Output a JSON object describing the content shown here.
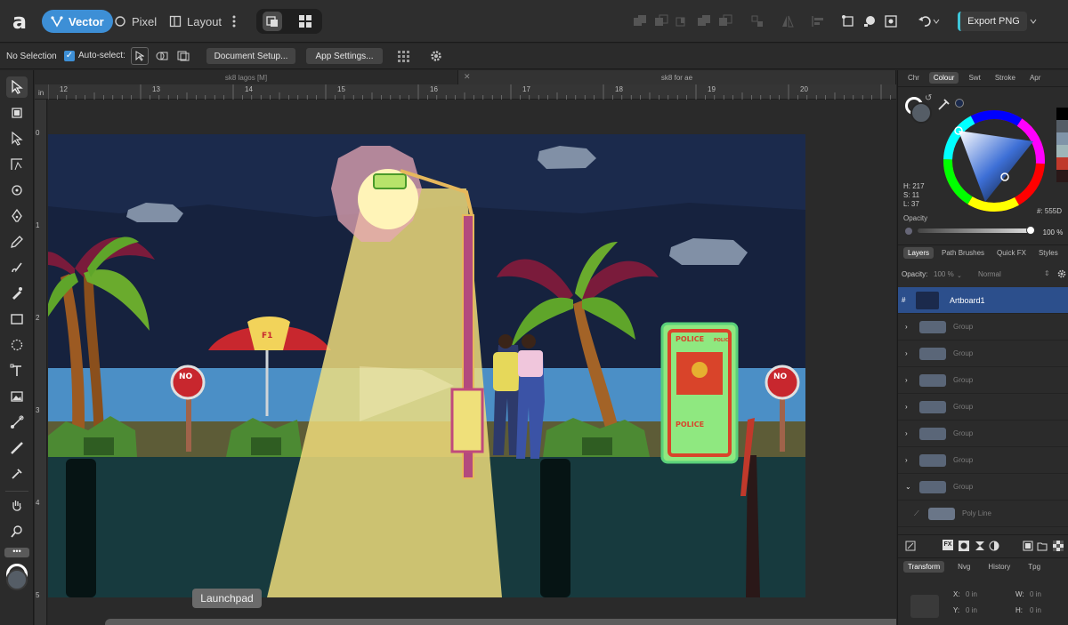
{
  "app": {
    "personas": [
      {
        "label": "Vector",
        "active": true
      },
      {
        "label": "Pixel",
        "active": false
      },
      {
        "label": "Layout",
        "active": false
      }
    ],
    "export_label": "Export PNG",
    "accent": "#3d8fd6"
  },
  "context": {
    "selection": "No Selection",
    "autoselect_label": "Auto-select:",
    "document_setup": "Document Setup...",
    "app_settings": "App Settings..."
  },
  "tabs": [
    {
      "label": "sk8 lagos [M]",
      "active": false
    },
    {
      "label": "sk8 for ae",
      "active": true
    }
  ],
  "ruler": {
    "unit": "in",
    "h_ticks": [
      "12",
      "13",
      "14",
      "15",
      "16",
      "17",
      "18",
      "19",
      "20"
    ],
    "v_ticks": [
      "0",
      "1",
      "2",
      "3",
      "4",
      "5"
    ]
  },
  "canvas": {
    "sign_text": "NO",
    "booth_top": "POLICE",
    "booth_side": "POLICE",
    "booth_bottom": "POLICE",
    "umbrella_text": "F1",
    "launchpad_label": "Launchpad",
    "sky_color": "#1b2a4c",
    "sea_color": "#4b8fc6",
    "ground_color": "#173a3e",
    "light_color": "#f4e07c"
  },
  "colour_panel": {
    "tabs": [
      "Chr",
      "Colour",
      "Swt",
      "Stroke",
      "Apr"
    ],
    "active_tab": "Colour",
    "h": "H: 217",
    "s": "S: 11",
    "l": "L: 37",
    "hex": "#: 555D",
    "opacity_label": "Opacity",
    "opacity_value": "100 %",
    "current_color": "#555d66"
  },
  "layers_panel": {
    "tabs": [
      "Layers",
      "Path Brushes",
      "Quick FX",
      "Styles"
    ],
    "opacity_label": "Opacity:",
    "opacity_value": "100 %",
    "blend_mode": "Normal",
    "items": [
      {
        "name": "Artboard1",
        "selected": true
      },
      {
        "name": "Group"
      },
      {
        "name": "Group"
      },
      {
        "name": "Group"
      },
      {
        "name": "Group"
      },
      {
        "name": "Group"
      },
      {
        "name": "Group"
      },
      {
        "name": "Group"
      },
      {
        "name": "Poly Line"
      }
    ]
  },
  "transform_panel": {
    "tabs": [
      "Transform",
      "Nvg",
      "History",
      "Tpg"
    ],
    "x": "0 in",
    "y": "0 in",
    "w": "0 in",
    "h": "0 in",
    "x_label": "X:",
    "y_label": "Y:",
    "w_label": "W:",
    "h_label": "H:"
  }
}
